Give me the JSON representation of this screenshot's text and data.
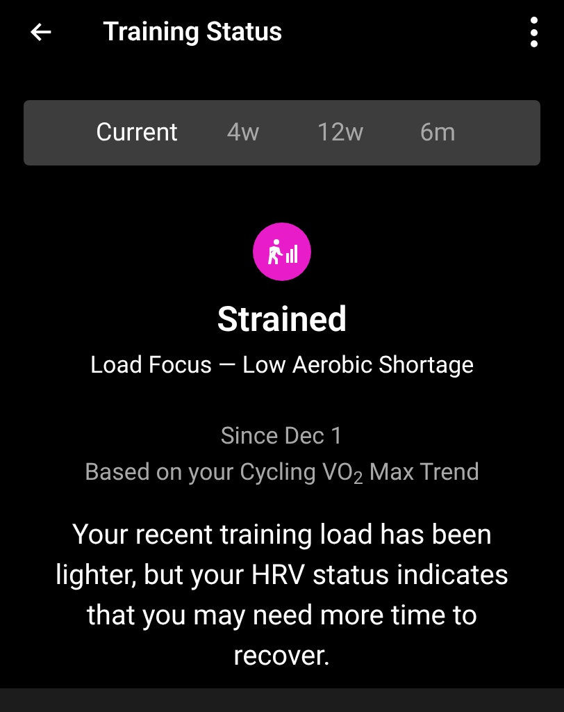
{
  "header": {
    "title": "Training Status"
  },
  "tabs": [
    {
      "label": "Current",
      "selected": true
    },
    {
      "label": "4w",
      "selected": false
    },
    {
      "label": "12w",
      "selected": false
    },
    {
      "label": "6m",
      "selected": false
    }
  ],
  "status": {
    "name": "Strained",
    "load_focus": "Load Focus — Low Aerobic Shortage",
    "since": "Since Dec 1",
    "basis": "Based on your Cycling VO$_{2}$ Max Trend",
    "description": "Your recent training load has been lighter, but your HRV status indicates that you may need more time to recover."
  }
}
